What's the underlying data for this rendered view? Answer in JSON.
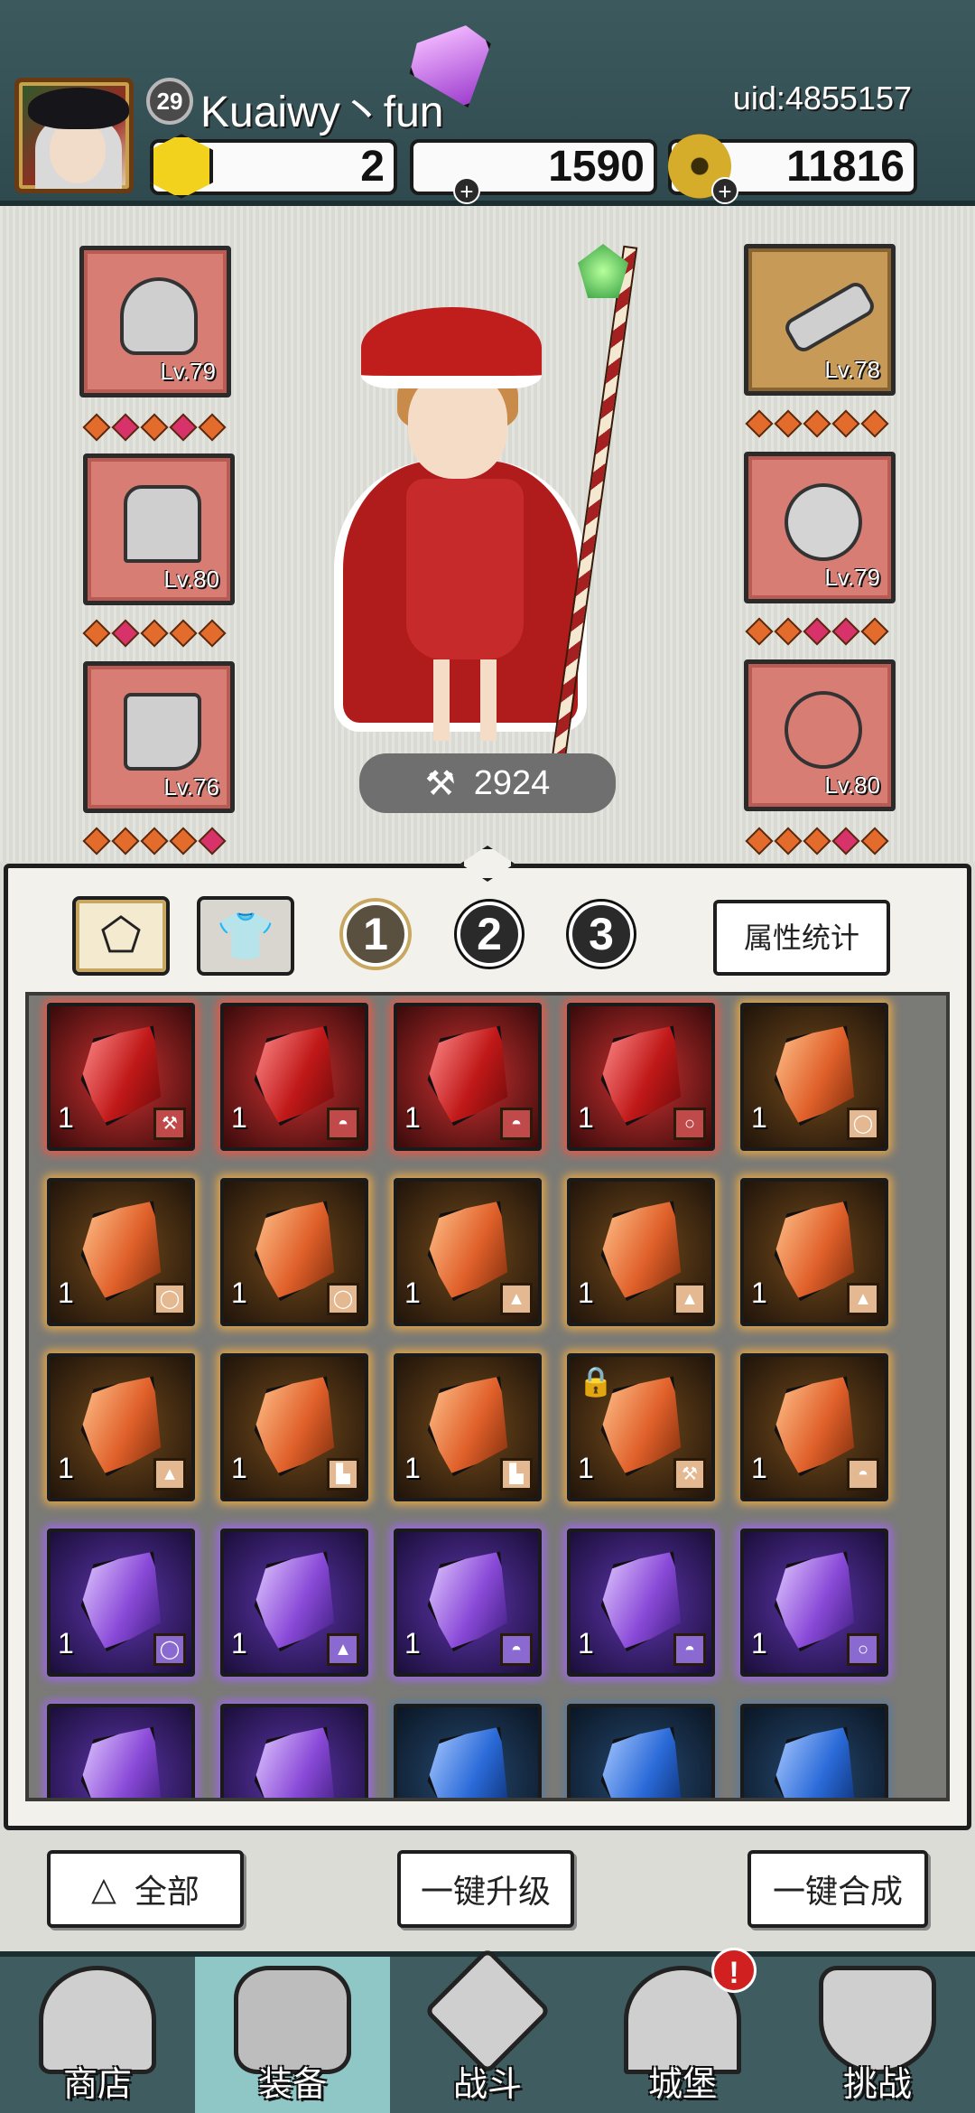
{
  "header": {
    "level": "29",
    "username": "Kuaiwy丶fun",
    "uid": "uid:4855157",
    "currencies": {
      "gold_cubes": "2",
      "gems": "1590",
      "coins": "11816"
    }
  },
  "equipment": {
    "left": [
      {
        "name": "helmet",
        "level": "Lv.79"
      },
      {
        "name": "armor",
        "level": "Lv.80"
      },
      {
        "name": "boots",
        "level": "Lv.76"
      }
    ],
    "right": [
      {
        "name": "weapon",
        "level": "Lv.78"
      },
      {
        "name": "ring",
        "level": "Lv.79"
      },
      {
        "name": "necklace",
        "level": "Lv.80"
      }
    ],
    "power": "2924"
  },
  "inventory": {
    "tabs": [
      "1",
      "2",
      "3"
    ],
    "stats_button": "属性统计",
    "items_qty": "1"
  },
  "actions": {
    "all": "全部",
    "upgrade_all": "一键升级",
    "merge_all": "一键合成"
  },
  "nav": {
    "shop": "商店",
    "equipment": "装备",
    "battle": "战斗",
    "castle": "城堡",
    "challenge": "挑战",
    "alert": "!"
  },
  "colors": {
    "header_bg": "#3c5a5e",
    "slot_red": "#d87d74",
    "nav_active": "#8fc7c6"
  }
}
